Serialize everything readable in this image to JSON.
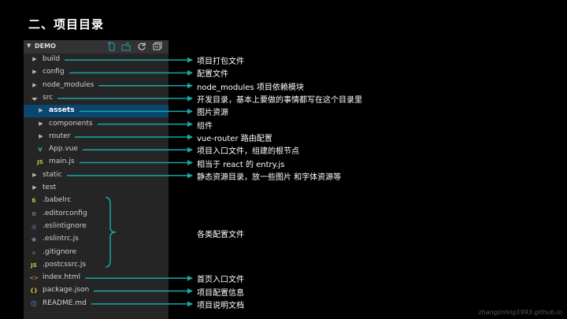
{
  "slide": {
    "title": "二、项目目录"
  },
  "explorer": {
    "header_title": "DEMO",
    "header_icons": [
      "new-file-icon",
      "new-folder-icon",
      "refresh-icon",
      "collapse-all-icon"
    ]
  },
  "tree": [
    {
      "label": "build",
      "kind": "folder",
      "expanded": false,
      "icon": "chevron-right-icon"
    },
    {
      "label": "config",
      "kind": "folder",
      "expanded": false,
      "icon": "chevron-right-icon"
    },
    {
      "label": "node_modules",
      "kind": "folder",
      "expanded": false,
      "icon": "chevron-right-icon"
    },
    {
      "label": "src",
      "kind": "folder",
      "expanded": true,
      "icon": "chevron-down-icon"
    },
    {
      "label": "assets",
      "kind": "folder",
      "expanded": false,
      "icon": "chevron-right-icon",
      "selected": true
    },
    {
      "label": "components",
      "kind": "folder",
      "expanded": false,
      "icon": "chevron-right-icon"
    },
    {
      "label": "router",
      "kind": "folder",
      "expanded": false,
      "icon": "chevron-right-icon"
    },
    {
      "label": "App.vue",
      "kind": "file",
      "icon": "vue-file-icon",
      "glyph": "V",
      "color": "#41b883"
    },
    {
      "label": "main.js",
      "kind": "file",
      "icon": "js-file-icon",
      "glyph": "JS",
      "color": "#cbcb41"
    },
    {
      "label": "static",
      "kind": "folder",
      "expanded": false,
      "icon": "chevron-right-icon"
    },
    {
      "label": "test",
      "kind": "folder",
      "expanded": false,
      "icon": "chevron-right-icon"
    },
    {
      "label": ".babelrc",
      "kind": "file",
      "icon": "babel-file-icon",
      "glyph": "б",
      "color": "#cbcb41"
    },
    {
      "label": ".editorconfig",
      "kind": "file",
      "icon": "gear-file-icon",
      "glyph": "⚙",
      "color": "#9a9a9a"
    },
    {
      "label": ".eslintignore",
      "kind": "file",
      "icon": "eslint-file-icon",
      "glyph": "◎",
      "color": "#8a8aa8"
    },
    {
      "label": ".eslintrc.js",
      "kind": "file",
      "icon": "eslint-file-icon",
      "glyph": "◉",
      "color": "#a074c4"
    },
    {
      "label": ".gitignore",
      "kind": "file",
      "icon": "git-file-icon",
      "glyph": "◆",
      "color": "#41535b"
    },
    {
      "label": ".postcssrc.js",
      "kind": "file",
      "icon": "js-file-icon",
      "glyph": "JS",
      "color": "#cbcb41"
    },
    {
      "label": "index.html",
      "kind": "file",
      "icon": "html-file-icon",
      "glyph": "<>",
      "color": "#e37933"
    },
    {
      "label": "package.json",
      "kind": "file",
      "icon": "json-file-icon",
      "glyph": "{}",
      "color": "#cbcb41"
    },
    {
      "label": "README.md",
      "kind": "file",
      "icon": "info-file-icon",
      "glyph": "ⓘ",
      "color": "#519aba"
    }
  ],
  "annotations": [
    {
      "text": "项目打包文件",
      "row": 0
    },
    {
      "text": "配置文件",
      "row": 1
    },
    {
      "text": "node_modules 项目依赖模块",
      "row": 2
    },
    {
      "text": "开发目录，基本上要做的事情都写在这个目录里",
      "row": 3
    },
    {
      "text": "图片资源",
      "row": 4
    },
    {
      "text": "组件",
      "row": 5
    },
    {
      "text": "vue-router 路由配置",
      "row": 6
    },
    {
      "text": "项目入口文件，组建的根节点",
      "row": 7
    },
    {
      "text": "相当于 react 的 entry.js",
      "row": 8
    },
    {
      "text": "静态资源目录，放一些图片 和字体资源等",
      "row": 9
    },
    {
      "text": "各类配置文件",
      "row": 13
    },
    {
      "text": "首页入口文件",
      "row": 17
    },
    {
      "text": "项目配置信息",
      "row": 18
    },
    {
      "text": "项目说明文档",
      "row": 19
    }
  ],
  "colors": {
    "arrow": "#19a6a6",
    "selection": "#094771",
    "sidebar": "#252526"
  },
  "watermark": "zhangjinling1993.github.io"
}
